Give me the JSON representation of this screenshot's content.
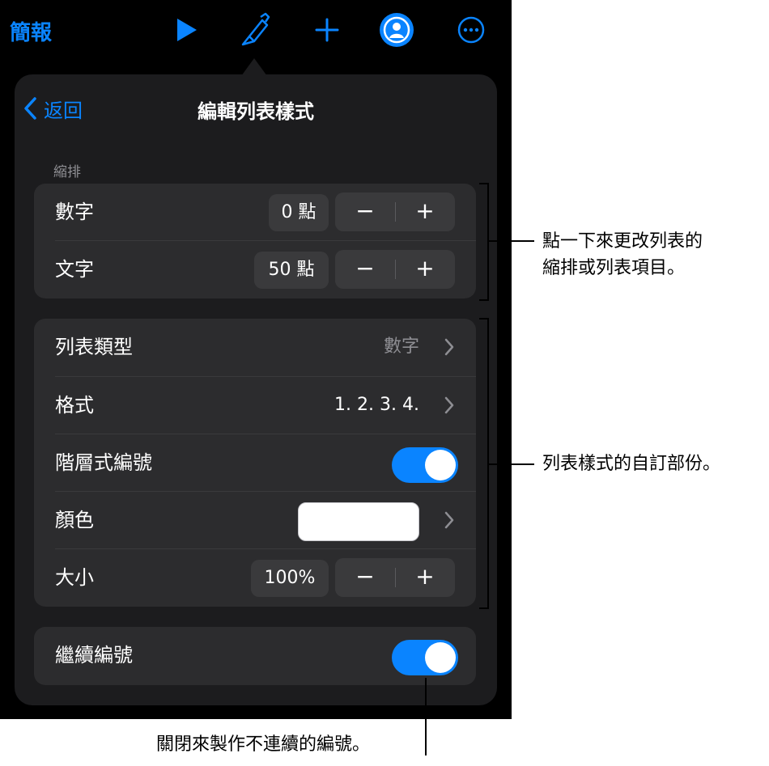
{
  "toolbar": {
    "app_title": "簡報",
    "icons": [
      "play-icon",
      "paintbrush-icon",
      "plus-icon",
      "collaborate-icon",
      "more-icon"
    ]
  },
  "panel": {
    "back_label": "返回",
    "title": "編輯列表樣式",
    "indent_section_label": "縮排",
    "indent_rows": [
      {
        "label": "數字",
        "value": "0 點",
        "minus": "−",
        "plus": "+"
      },
      {
        "label": "文字",
        "value": "50 點",
        "minus": "−",
        "plus": "+"
      }
    ],
    "style_rows": {
      "list_type": {
        "label": "列表類型",
        "value": "數字"
      },
      "format": {
        "label": "格式",
        "value": "1. 2. 3. 4."
      },
      "tiered": {
        "label": "階層式編號",
        "on": true
      },
      "color": {
        "label": "顏色",
        "swatch": "#ffffff"
      },
      "size": {
        "label": "大小",
        "value": "100%",
        "minus": "−",
        "plus": "+"
      }
    },
    "continue_numbering": {
      "label": "繼續編號",
      "on": true
    }
  },
  "callouts": {
    "indent_line1": "點一下來更改列表的",
    "indent_line2": "縮排或列表項目。",
    "style": "列表樣式的自訂部份。",
    "continue": "關閉來製作不連續的編號。"
  },
  "colors": {
    "accent": "#0a84ff",
    "panel_bg": "#1c1c1e",
    "group_bg": "#2c2c2e",
    "control_bg": "#3a3a3c"
  }
}
